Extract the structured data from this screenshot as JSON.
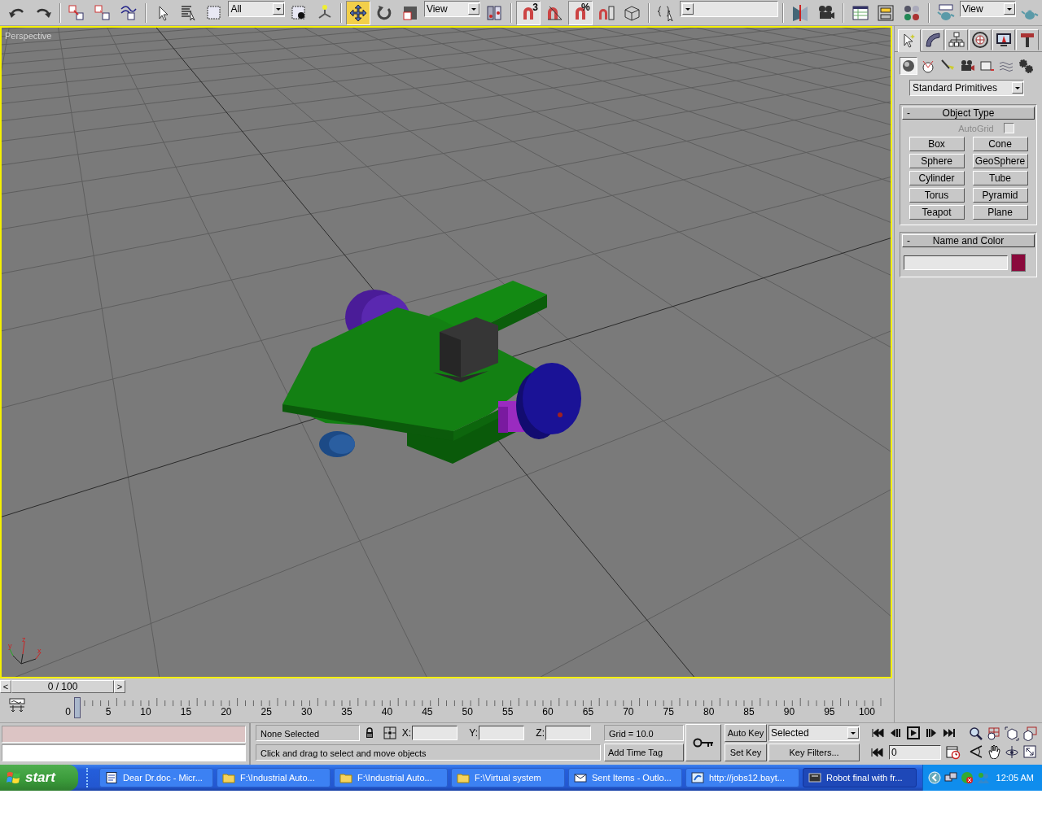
{
  "toolbar": [
    {
      "kind": "icon",
      "selected": false
    },
    {
      "kind": "icon",
      "selected": false
    },
    {
      "kind": "sep"
    },
    {
      "kind": "icon",
      "selected": false
    },
    {
      "kind": "icon",
      "selected": false
    },
    {
      "kind": "icon",
      "selected": false
    },
    {
      "kind": "sep"
    },
    {
      "kind": "icon",
      "selected": false
    },
    {
      "kind": "icon",
      "selected": false
    },
    {
      "kind": "icon",
      "selected": false
    },
    {
      "kind": "dropdown",
      "value": "All"
    },
    {
      "kind": "icon",
      "selected": false
    },
    {
      "kind": "icon",
      "selected": false
    },
    {
      "kind": "sep"
    },
    {
      "kind": "icon",
      "selected": true
    },
    {
      "kind": "icon",
      "selected": false
    },
    {
      "kind": "icon",
      "selected": false
    },
    {
      "kind": "dropdown",
      "value": "View"
    },
    {
      "kind": "icon",
      "selected": false
    },
    {
      "kind": "sep"
    },
    {
      "kind": "icon",
      "selected": true,
      "badge": "3"
    },
    {
      "kind": "icon",
      "selected": false
    },
    {
      "kind": "icon",
      "selected": true,
      "badge": "%"
    },
    {
      "kind": "icon",
      "selected": false
    },
    {
      "kind": "icon",
      "selected": false
    },
    {
      "kind": "sep"
    },
    {
      "kind": "icon",
      "selected": false
    },
    {
      "kind": "dropdown"
    },
    {
      "kind": "sep"
    },
    {
      "kind": "icon",
      "selected": false
    },
    {
      "kind": "icon",
      "selected": false
    },
    {
      "kind": "sep"
    },
    {
      "kind": "icon",
      "selected": false
    },
    {
      "kind": "icon",
      "selected": false
    },
    {
      "kind": "icon",
      "selected": false
    },
    {
      "kind": "sep"
    },
    {
      "kind": "icon",
      "selected": false
    },
    {
      "kind": "dropdown",
      "value": "View"
    },
    {
      "kind": "icon",
      "selected": false
    }
  ],
  "viewport": {
    "label": "Perspective",
    "axes": [
      "x",
      "y",
      "z"
    ]
  },
  "command_panel": {
    "tabs": [
      {
        "selected": true
      },
      {
        "selected": false
      },
      {
        "selected": false
      },
      {
        "selected": false
      },
      {
        "selected": false
      },
      {
        "selected": false
      }
    ],
    "categories": [
      {
        "selected": true
      },
      {
        "selected": false
      },
      {
        "selected": false
      },
      {
        "selected": false
      },
      {
        "selected": false
      },
      {
        "selected": false
      },
      {
        "selected": false
      }
    ],
    "dropdown": "Standard Primitives",
    "object_type": {
      "title": "Object Type",
      "collapse": "-",
      "autogrid": {
        "label": "AutoGrid",
        "checked": false,
        "disabled": true
      },
      "buttons": [
        "Box",
        "Cone",
        "Sphere",
        "GeoSphere",
        "Cylinder",
        "Tube",
        "Torus",
        "Pyramid",
        "Teapot",
        "Plane"
      ]
    },
    "name_and_color": {
      "title": "Name and Color",
      "collapse": "-",
      "color": "#8a0a3c"
    }
  },
  "time_slider": {
    "prev": "<",
    "label": "0 / 100",
    "next": ">",
    "level": 0
  },
  "track_bar": {
    "labels": [
      "0",
      "5",
      "10",
      "15",
      "20",
      "25",
      "30",
      "35",
      "40",
      "45",
      "50",
      "55",
      "60",
      "65",
      "70",
      "75",
      "80",
      "85",
      "90",
      "95",
      "100"
    ]
  },
  "status": {
    "selection": "None Selected",
    "x_label": "X:",
    "y_label": "Y:",
    "z_label": "Z:",
    "prompt": "Click and drag to select and move objects",
    "grid": "Grid = 10.0",
    "time_tag": "Add Time Tag",
    "auto_key": "Auto Key",
    "set_key": "Set Key",
    "key_mode": "Selected",
    "key_filters": "Key Filters...",
    "frame": "0"
  },
  "taskbar": {
    "start": "start",
    "items": [
      {
        "label": "Dear Dr.doc - Micr...",
        "selected": false
      },
      {
        "label": "F:\\Industrial Auto...",
        "selected": false
      },
      {
        "label": "F:\\Industrial Auto...",
        "selected": false
      },
      {
        "label": "F:\\Virtual system",
        "selected": false
      },
      {
        "label": "Sent Items - Outlo...",
        "selected": false
      },
      {
        "label": "http://jobs12.bayt...",
        "selected": false
      },
      {
        "label": "Robot final with fr...",
        "selected": true
      }
    ],
    "clock": "12:05 AM"
  }
}
